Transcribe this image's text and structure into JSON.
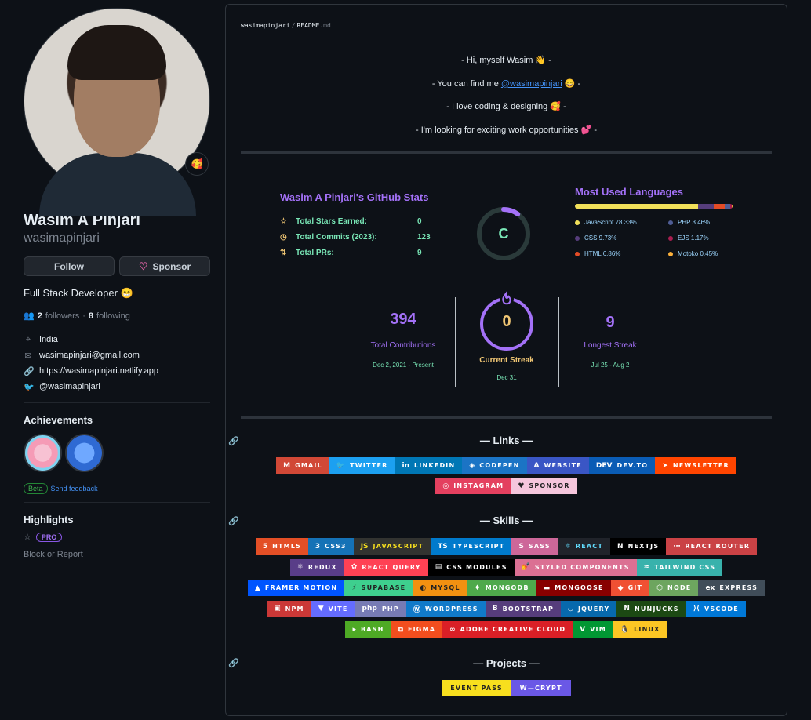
{
  "profile": {
    "status_emoji": "🥰",
    "name": "Wasim A Pinjari",
    "login": "wasimapinjari",
    "follow_label": "Follow",
    "sponsor_label": "Sponsor",
    "bio": "Full Stack Developer 😁",
    "followers_count": "2",
    "followers_label": "followers",
    "separator": "·",
    "following_count": "8",
    "following_label": "following",
    "location": "India",
    "email": "wasimapinjari@gmail.com",
    "website": "https://wasimapinjari.netlify.app",
    "twitter": "@wasimapinjari",
    "achievements_title": "Achievements",
    "beta_label": "Beta",
    "feedback_label": "Send feedback",
    "highlights_title": "Highlights",
    "pro_label": "PRO",
    "block_label": "Block or Report"
  },
  "readme": {
    "crumb_user": "wasimapinjari",
    "crumb_sep": "/",
    "crumb_file": "README",
    "crumb_ext": ".md",
    "intro_1": "- Hi, myself Wasim 👋 -",
    "intro_2_pre": "- You can find me ",
    "intro_2_link": "@wasimapinjari",
    "intro_2_post": " 😄 -",
    "intro_3": "- I love coding & designing 🥰 -",
    "intro_4": "- I'm looking for exciting work opportunities 💕 -"
  },
  "stats": {
    "title": "Wasim A Pinjari's GitHub Stats",
    "rows": [
      {
        "icon": "☆",
        "label": "Total Stars Earned:",
        "value": "0"
      },
      {
        "icon": "◷",
        "label": "Total Commits (2023):",
        "value": "123"
      },
      {
        "icon": "⇅",
        "label": "Total PRs:",
        "value": "9"
      }
    ],
    "rank": "C",
    "rank_progress": 0.1
  },
  "languages": {
    "title": "Most Used Languages",
    "items": [
      {
        "name": "JavaScript 78.33%",
        "color": "#f1e05a",
        "pct": 78.33
      },
      {
        "name": "CSS 9.73%",
        "color": "#563d7c",
        "pct": 9.73
      },
      {
        "name": "HTML 6.86%",
        "color": "#e34c26",
        "pct": 6.86
      },
      {
        "name": "PHP 3.46%",
        "color": "#4f5d95",
        "pct": 3.46
      },
      {
        "name": "EJS 1.17%",
        "color": "#a91e50",
        "pct": 1.17
      },
      {
        "name": "Motoko 0.45%",
        "color": "#fbb03b",
        "pct": 0.45
      }
    ]
  },
  "streak": {
    "total": "394",
    "total_label": "Total Contributions",
    "total_range": "Dec 2, 2021 - Present",
    "current": "0",
    "current_label": "Current Streak",
    "current_date": "Dec 31",
    "longest": "9",
    "longest_label": "Longest Streak",
    "longest_range": "Jul 25 - Aug 2"
  },
  "sections": {
    "links": "— Links —",
    "skills": "— Skills —",
    "projects": "— Projects —"
  },
  "links": [
    [
      {
        "label": "GMAIL",
        "icon": "M",
        "bg": "#d14836"
      },
      {
        "label": "TWITTER",
        "icon": "🐦",
        "bg": "#1ca0f1"
      },
      {
        "label": "LINKEDIN",
        "icon": "in",
        "bg": "#0077b5"
      },
      {
        "label": "CODEPEN",
        "icon": "◈",
        "bg": "#1b74c5"
      },
      {
        "label": "WEBSITE",
        "icon": "A",
        "bg": "#3a56c5"
      },
      {
        "label": "DEV.TO",
        "icon": "DEV",
        "bg": "#0a5cb5"
      },
      {
        "label": "NEWSLETTER",
        "icon": "➤",
        "bg": "#ff4500"
      }
    ],
    [
      {
        "label": "INSTAGRAM",
        "icon": "◎",
        "bg": "#e4405f"
      },
      {
        "label": "SPONSOR",
        "icon": "♥",
        "bg": "#ea4aaa",
        "dark": true,
        "bg2": "#f5c6dc"
      }
    ]
  ],
  "skills": [
    [
      {
        "label": "HTML5",
        "icon": "5",
        "bg": "#e34f26"
      },
      {
        "label": "CSS3",
        "icon": "3",
        "bg": "#1572b6"
      },
      {
        "label": "JAVASCRIPT",
        "icon": "JS",
        "bg": "#323330",
        "color": "#f7df1e"
      },
      {
        "label": "TYPESCRIPT",
        "icon": "TS",
        "bg": "#007acc"
      },
      {
        "label": "SASS",
        "icon": "S",
        "bg": "#cd6799"
      },
      {
        "label": "REACT",
        "icon": "⚛",
        "bg": "#20232a",
        "color": "#61dafb"
      },
      {
        "label": "NEXTJS",
        "icon": "N",
        "bg": "#000000"
      },
      {
        "label": "REACT ROUTER",
        "icon": "⋯",
        "bg": "#ca4245"
      }
    ],
    [
      {
        "label": "REDUX",
        "icon": "⚛",
        "bg": "#593d88"
      },
      {
        "label": "REACT QUERY",
        "icon": "✿",
        "bg": "#ff4154"
      },
      {
        "label": "CSS MODULES",
        "icon": "▤",
        "bg": "#000000"
      },
      {
        "label": "STYLED COMPONENTS",
        "icon": "💅",
        "bg": "#db7093"
      },
      {
        "label": "TAILWIND CSS",
        "icon": "≈",
        "bg": "#38b2ac"
      }
    ],
    [
      {
        "label": "FRAMER MOTION",
        "icon": "▲",
        "bg": "#0055ff"
      },
      {
        "label": "SUPABASE",
        "icon": "⚡",
        "bg": "#3ecf8e",
        "dark": true
      },
      {
        "label": "MYSQL",
        "icon": "◐",
        "bg": "#f29111",
        "dark": true
      },
      {
        "label": "MONGODB",
        "icon": "♦",
        "bg": "#4ea94b"
      },
      {
        "label": "MONGOOSE",
        "icon": "▬",
        "bg": "#880000"
      },
      {
        "label": "GIT",
        "icon": "◆",
        "bg": "#f05033"
      },
      {
        "label": "NODE",
        "icon": "⬡",
        "bg": "#6da55f"
      },
      {
        "label": "EXPRESS",
        "icon": "ex",
        "bg": "#404d59"
      }
    ],
    [
      {
        "label": "NPM",
        "icon": "▣",
        "bg": "#cb3837"
      },
      {
        "label": "VITE",
        "icon": "▼",
        "bg": "#646cff"
      },
      {
        "label": "PHP",
        "icon": "php",
        "bg": "#777bb4"
      },
      {
        "label": "WORDPRESS",
        "icon": "Ⓦ",
        "bg": "#117ac9"
      },
      {
        "label": "BOOTSTRAP",
        "icon": "B",
        "bg": "#563d7c"
      },
      {
        "label": "JQUERY",
        "icon": "◡",
        "bg": "#0769ad"
      },
      {
        "label": "NUNJUCKS",
        "icon": "N",
        "bg": "#1c4913"
      },
      {
        "label": "VSCODE",
        "icon": "⟩⟨",
        "bg": "#0078d7"
      }
    ],
    [
      {
        "label": "BASH",
        "icon": "▸",
        "bg": "#4eaa25"
      },
      {
        "label": "FIGMA",
        "icon": "⧉",
        "bg": "#f24e1e"
      },
      {
        "label": "ADOBE CREATIVE CLOUD",
        "icon": "∞",
        "bg": "#da1f26"
      },
      {
        "label": "VIM",
        "icon": "V",
        "bg": "#019733"
      },
      {
        "label": "LINUX",
        "icon": "🐧",
        "bg": "#fcc624",
        "dark": true
      }
    ]
  ],
  "projects": [
    {
      "label": "EVENT PASS",
      "icon": "",
      "bg": "#f7df1e",
      "dark": true
    },
    {
      "label": "W—CRYPT",
      "icon": "",
      "bg": "#6a58e6"
    }
  ]
}
